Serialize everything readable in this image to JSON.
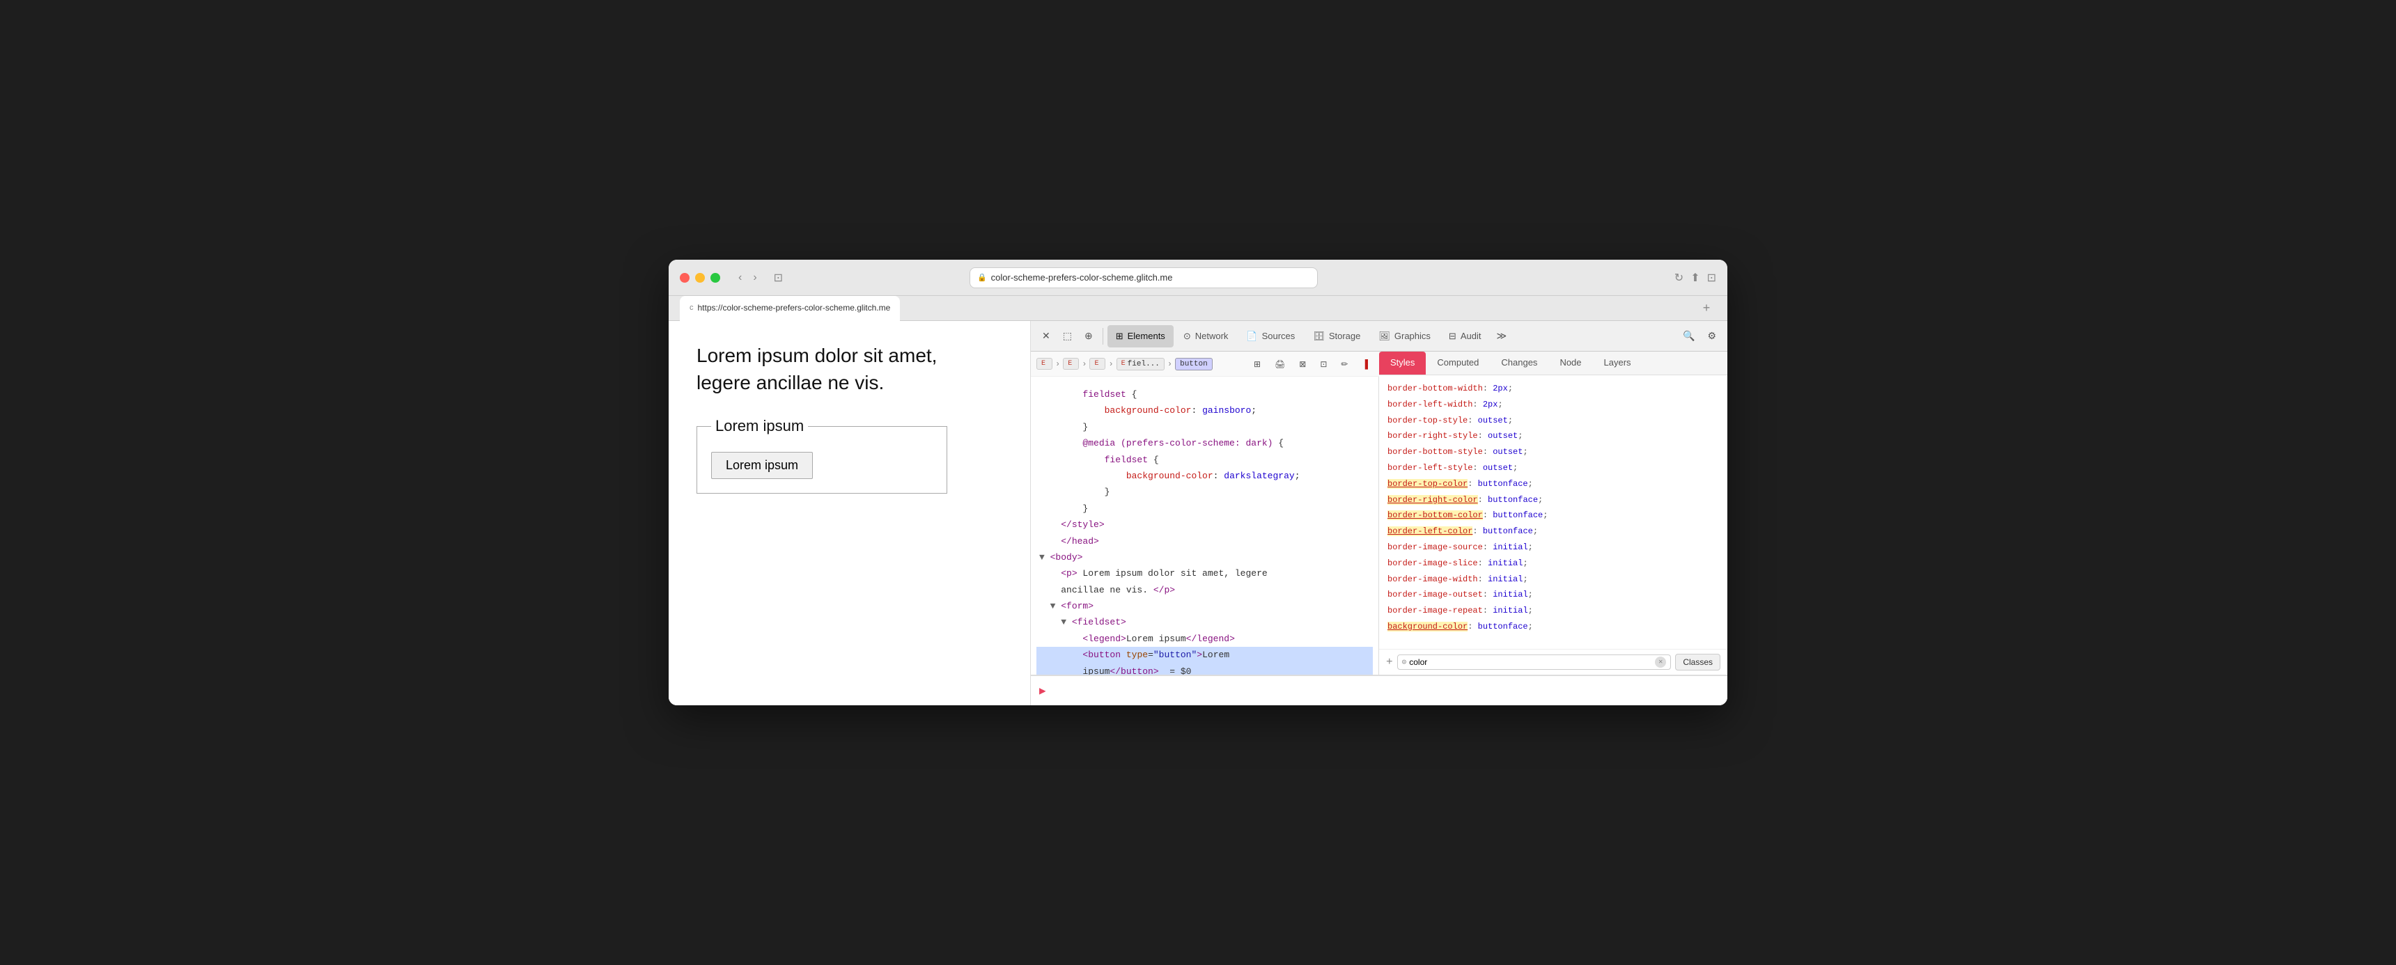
{
  "browser": {
    "title": "color-scheme-prefers-color-scheme.glitch.me",
    "url": "https://color-scheme-prefers-color-scheme.glitch.me",
    "tab_favicon": "c",
    "tab_label": "https://color-scheme-prefers-color-scheme.glitch.me",
    "new_tab_label": "+"
  },
  "webpage": {
    "paragraph": "Lorem ipsum dolor sit amet,\nlegere ancillae ne vis.",
    "legend": "Lorem ipsum",
    "button": "Lorem ipsum"
  },
  "devtools": {
    "toolbar": {
      "close_label": "×",
      "device_label": "⬚",
      "inspect_label": "⊕",
      "elements_label": "Elements",
      "network_label": "Network",
      "sources_label": "Sources",
      "storage_label": "Storage",
      "graphics_label": "Graphics",
      "audit_label": "Audit",
      "more_label": "≫",
      "search_label": "🔍",
      "settings_label": "⚙"
    },
    "breadcrumb": {
      "items": [
        "E",
        "E",
        "E",
        "fiel...",
        "button"
      ]
    },
    "breadcrumb_icons": [
      "grid",
      "print",
      "squares",
      "grid2",
      "edit",
      "block"
    ],
    "dom": {
      "lines": [
        "        fieldset {",
        "            background-color: gainsboro;",
        "        }",
        "        @media (prefers-color-scheme: dark) {",
        "            fieldset {",
        "                background-color: darkslategray;",
        "            }",
        "        }",
        "    </style>",
        "    </head>",
        "▼ <body>",
        "    <p> Lorem ipsum dolor sit amet, legere",
        "    ancillae ne vis. </p>",
        "  ▼ <form>",
        "    ▼ <fieldset>",
        "        <legend>Lorem ipsum</legend>",
        "        <button type=\"button\">Lorem",
        "        ipsum</button>  = $0"
      ]
    },
    "styles": {
      "tabs": [
        "Styles",
        "Computed",
        "Changes",
        "Node",
        "Layers"
      ],
      "active_tab": "Styles",
      "properties": [
        {
          "name": "border-bottom-width",
          "value": "2px",
          "highlighted": false
        },
        {
          "name": "border-left-width",
          "value": "2px",
          "highlighted": false
        },
        {
          "name": "border-top-style",
          "value": "outset",
          "highlighted": false
        },
        {
          "name": "border-right-style",
          "value": "outset",
          "highlighted": false
        },
        {
          "name": "border-bottom-style",
          "value": "outset",
          "highlighted": false
        },
        {
          "name": "border-left-style",
          "value": "outset",
          "highlighted": false
        },
        {
          "name": "border-top-color",
          "value": "buttonface",
          "highlighted": true
        },
        {
          "name": "border-right-color",
          "value": "buttonface",
          "highlighted": true
        },
        {
          "name": "border-bottom-color",
          "value": "buttonface",
          "highlighted": true
        },
        {
          "name": "border-left-color",
          "value": "buttonface",
          "highlighted": true
        },
        {
          "name": "border-image-source",
          "value": "initial",
          "highlighted": false
        },
        {
          "name": "border-image-slice",
          "value": "initial",
          "highlighted": false
        },
        {
          "name": "border-image-width",
          "value": "initial",
          "highlighted": false
        },
        {
          "name": "border-image-outset",
          "value": "initial",
          "highlighted": false
        },
        {
          "name": "border-image-repeat",
          "value": "initial",
          "highlighted": false
        },
        {
          "name": "background-color",
          "value": "buttonface",
          "highlighted": true
        }
      ],
      "filter_placeholder": "color",
      "classes_label": "Classes"
    }
  }
}
